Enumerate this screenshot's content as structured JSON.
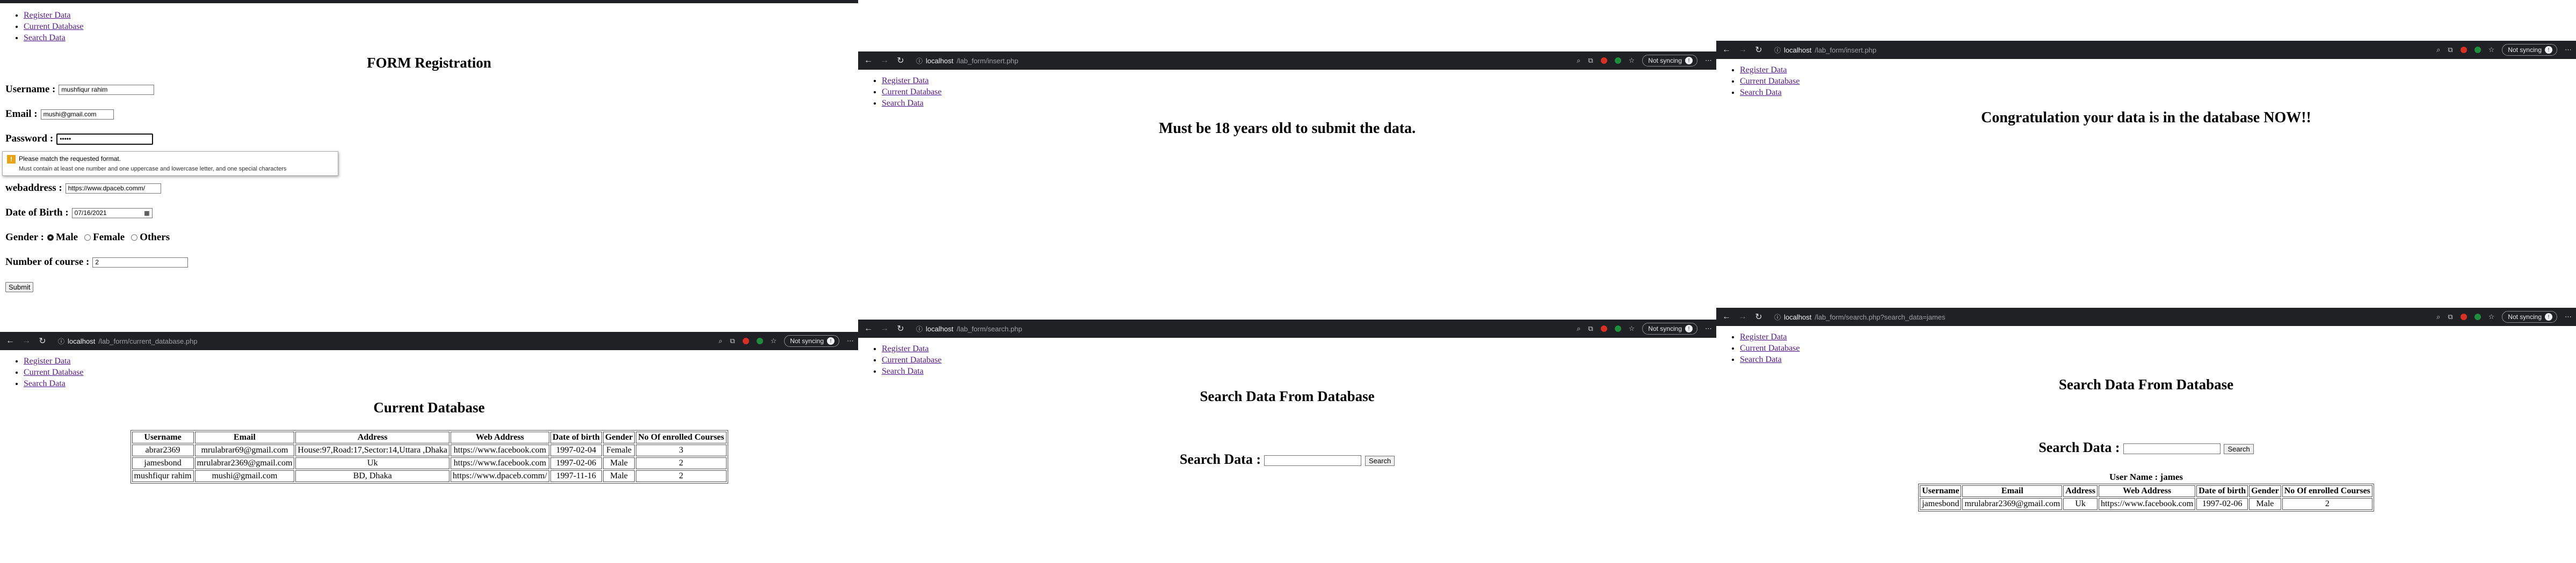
{
  "nav_links": [
    "Register Data",
    "Current Database",
    "Search Data"
  ],
  "browser": {
    "not_syncing": "Not syncing",
    "host": "localhost",
    "urls": [
      "/lab_form/insert.php",
      "/lab_form/insert.php",
      "/lab_form/current_database.php",
      "/lab_form/search.php",
      "/lab_form/search.php?search_data=james"
    ]
  },
  "form": {
    "title": "FORM Registration",
    "username_label": "Username :",
    "username_value": "mushfiqur rahim",
    "email_label": "Email :",
    "email_value": "mushi@gmail.com",
    "password_label": "Password :",
    "password_value": "•••••",
    "tooltip_title": "Please match the requested format.",
    "tooltip_detail": "Must contain at least one number and one uppercase and lowercase letter, and one special characters",
    "web_label": "webaddress :",
    "web_value": "https://www.dpaceb.comm/",
    "dob_label": "Date of Birth :",
    "dob_value": "07/16/2021",
    "gender_label": "Gender :",
    "gender_options": [
      "Male",
      "Female",
      "Others"
    ],
    "gender_selected": "Male",
    "courses_label": "Number of course :",
    "courses_value": "2",
    "submit_label": "Submit"
  },
  "insert_error": {
    "message": "Must be 18 years old to submit the data."
  },
  "insert_success": {
    "message": "Congratulation your data is in the database NOW!!"
  },
  "current_db": {
    "title": "Current Database",
    "headers": [
      "Username",
      "Email",
      "Address",
      "Web Address",
      "Date of birth",
      "Gender",
      "No Of enrolled Courses"
    ],
    "rows": [
      [
        "abrar2369",
        "mrulabrar69@gmail.com",
        "House:97,Road:17,Sector:14,Uttara ,Dhaka",
        "https://www.facebook.com",
        "1997-02-04",
        "Female",
        "3"
      ],
      [
        "jamesbond",
        "mrulabrar2369@gmail.com",
        "Uk",
        "https://www.facebook.com",
        "1997-02-06",
        "Male",
        "2"
      ],
      [
        "mushfiqur rahim",
        "mushi@gmail.com",
        "BD, Dhaka",
        "https://www.dpaceb.comm/",
        "1997-11-16",
        "Male",
        "2"
      ]
    ]
  },
  "search": {
    "title": "Search Data From Database",
    "label": "Search Data :",
    "button": "Search"
  },
  "search_result": {
    "title": "Search Data From Database",
    "label": "Search Data :",
    "button": "Search",
    "user_name": "User Name : james",
    "headers": [
      "Username",
      "Email",
      "Address",
      "Web Address",
      "Date of birth",
      "Gender",
      "No Of enrolled Courses"
    ],
    "rows": [
      [
        "jamesbond",
        "mrulabrar2369@gmail.com",
        "Uk",
        "https://www.facebook.com",
        "1997-02-06",
        "Male",
        "2"
      ]
    ]
  }
}
